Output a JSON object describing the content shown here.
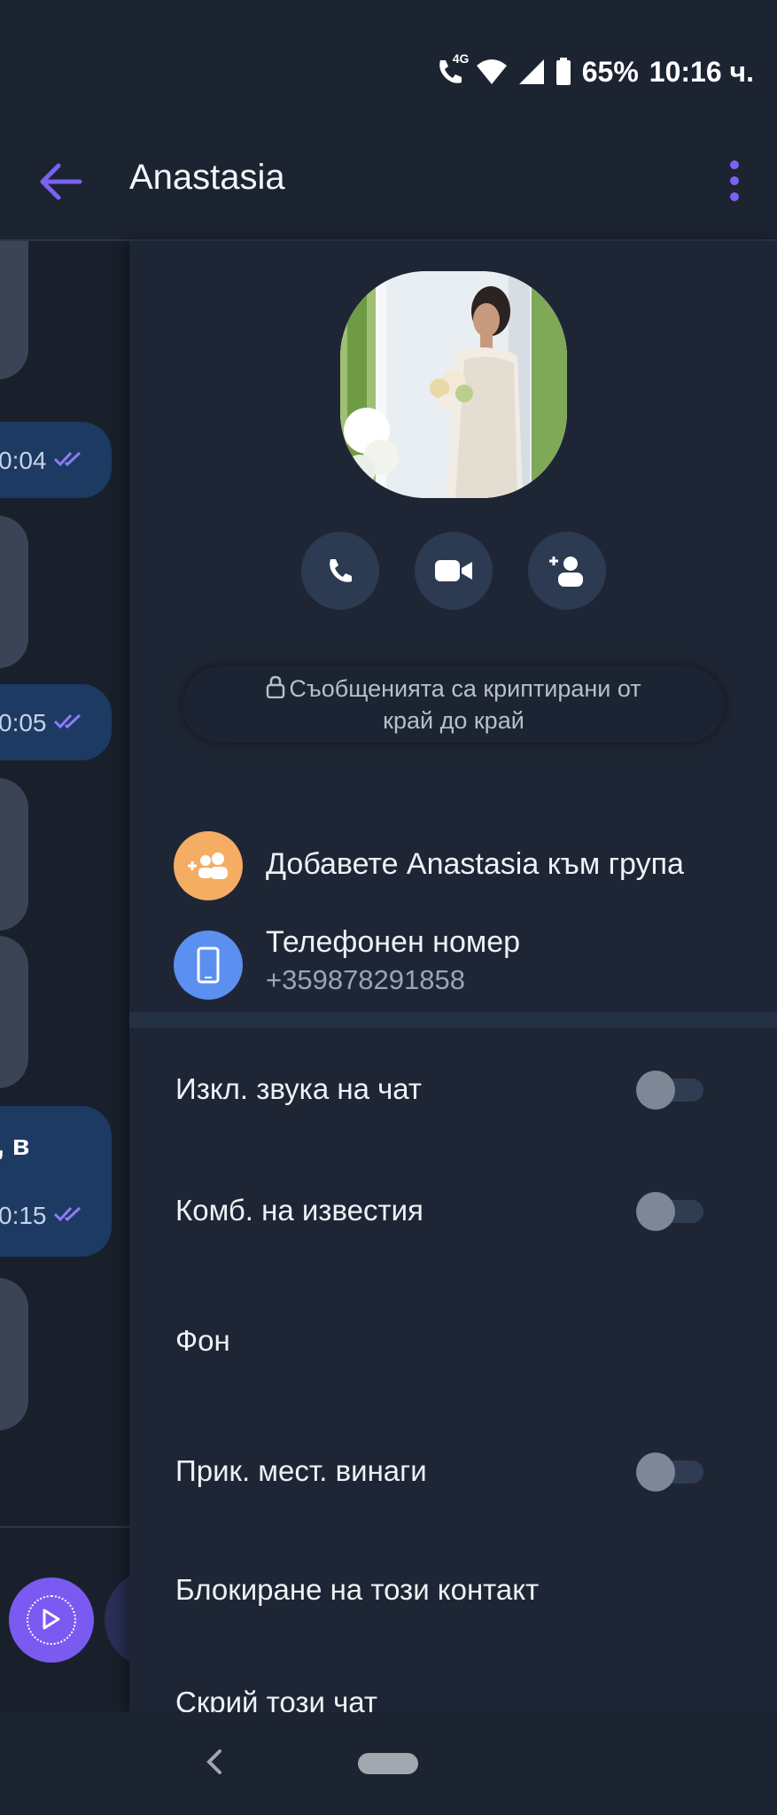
{
  "status_bar": {
    "network": "4G",
    "battery": "65%",
    "time": "10:16 ч."
  },
  "app_bar": {
    "title": "Anastasia"
  },
  "chat": {
    "time_1": "0:04",
    "time_2": "0:05",
    "fragment": ", в",
    "time_3": "0:15"
  },
  "contact": {
    "encryption_note_line1": "Съобщенията са криптирани от",
    "encryption_note_line2": "край до край",
    "add_to_group": "Добавете Anastasia към група",
    "phone_label": "Телефонен номер",
    "phone_number": "+359878291858"
  },
  "settings": [
    {
      "label": "Изкл. звука на чат",
      "toggle": false
    },
    {
      "label": "Комб. на известия",
      "toggle": false
    },
    {
      "label": "Фон"
    },
    {
      "label": "Прик. мест. винаги",
      "toggle": false
    },
    {
      "label": "Блокиране на този контакт"
    },
    {
      "label": "Скрий този чат"
    }
  ],
  "colors": {
    "accent": "#7a5af0",
    "add_group_icon_bg": "#f5ad63",
    "phone_icon_bg": "#5b8ff0"
  },
  "icons": [
    "call-icon",
    "video-icon",
    "add-contact-icon",
    "lock-icon",
    "group-add-icon",
    "smartphone-icon"
  ]
}
